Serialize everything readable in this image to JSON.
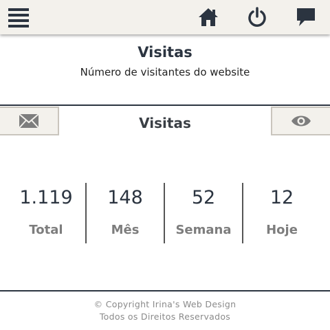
{
  "topbar": {
    "icons": [
      "menu-icon",
      "home-icon",
      "power-icon",
      "chat-icon"
    ]
  },
  "header": {
    "title": "Visitas",
    "subtitle": "Número de visitantes do website"
  },
  "section": {
    "title": "Visitas",
    "left_button_icon": "mail-icon",
    "right_button_icon": "eye-icon"
  },
  "stats": [
    {
      "value": "1.119",
      "label": "Total"
    },
    {
      "value": "148",
      "label": "Mês"
    },
    {
      "value": "52",
      "label": "Semana"
    },
    {
      "value": "12",
      "label": "Hoje"
    }
  ],
  "footer": {
    "copyright": "© Copyright Irina's Web Design",
    "rights": "Todos os Direitos Reservados"
  },
  "colors": {
    "topbar_bg": "#f3f1ec",
    "icon_dark": "#2b3440",
    "label_gray": "#7d7d7d"
  }
}
